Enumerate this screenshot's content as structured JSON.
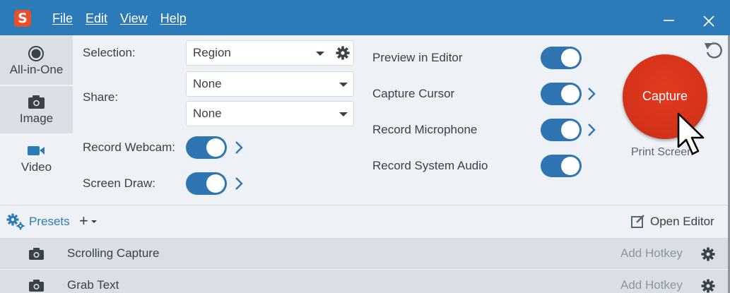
{
  "app": {
    "logo_letter": "S",
    "menu": [
      "File",
      "Edit",
      "View",
      "Help"
    ]
  },
  "tabs": [
    {
      "label": "All-in-One",
      "icon": "record-circle-icon",
      "selected": false
    },
    {
      "label": "Image",
      "icon": "camera-icon",
      "selected": false
    },
    {
      "label": "Video",
      "icon": "video-camera-icon",
      "selected": true
    }
  ],
  "settings": {
    "selection_label": "Selection:",
    "selection_value": "Region",
    "share_label": "Share:",
    "share_values": [
      "None",
      "None"
    ],
    "record_webcam_label": "Record Webcam:",
    "record_webcam_on": true,
    "screen_draw_label": "Screen Draw:",
    "screen_draw_on": true
  },
  "options": [
    {
      "label": "Preview in Editor",
      "on": true,
      "has_more": false
    },
    {
      "label": "Capture Cursor",
      "on": true,
      "has_more": true
    },
    {
      "label": "Record Microphone",
      "on": true,
      "has_more": true
    },
    {
      "label": "Record System Audio",
      "on": true,
      "has_more": false
    }
  ],
  "capture": {
    "button_label": "Capture",
    "hotkey_label": "Print Screen"
  },
  "presets": {
    "label": "Presets",
    "add_label": "+",
    "open_editor_label": "Open Editor",
    "items": [
      {
        "name": "Scrolling Capture",
        "hotkey": "Add Hotkey",
        "icon": "camera-icon"
      },
      {
        "name": "Grab Text",
        "hotkey": "Add Hotkey",
        "icon": "camera-icon"
      }
    ]
  },
  "colors": {
    "titlebar": "#2c7ab8",
    "accent": "#2f75b1",
    "capture": "#d3321a",
    "logo": "#e8502a"
  }
}
